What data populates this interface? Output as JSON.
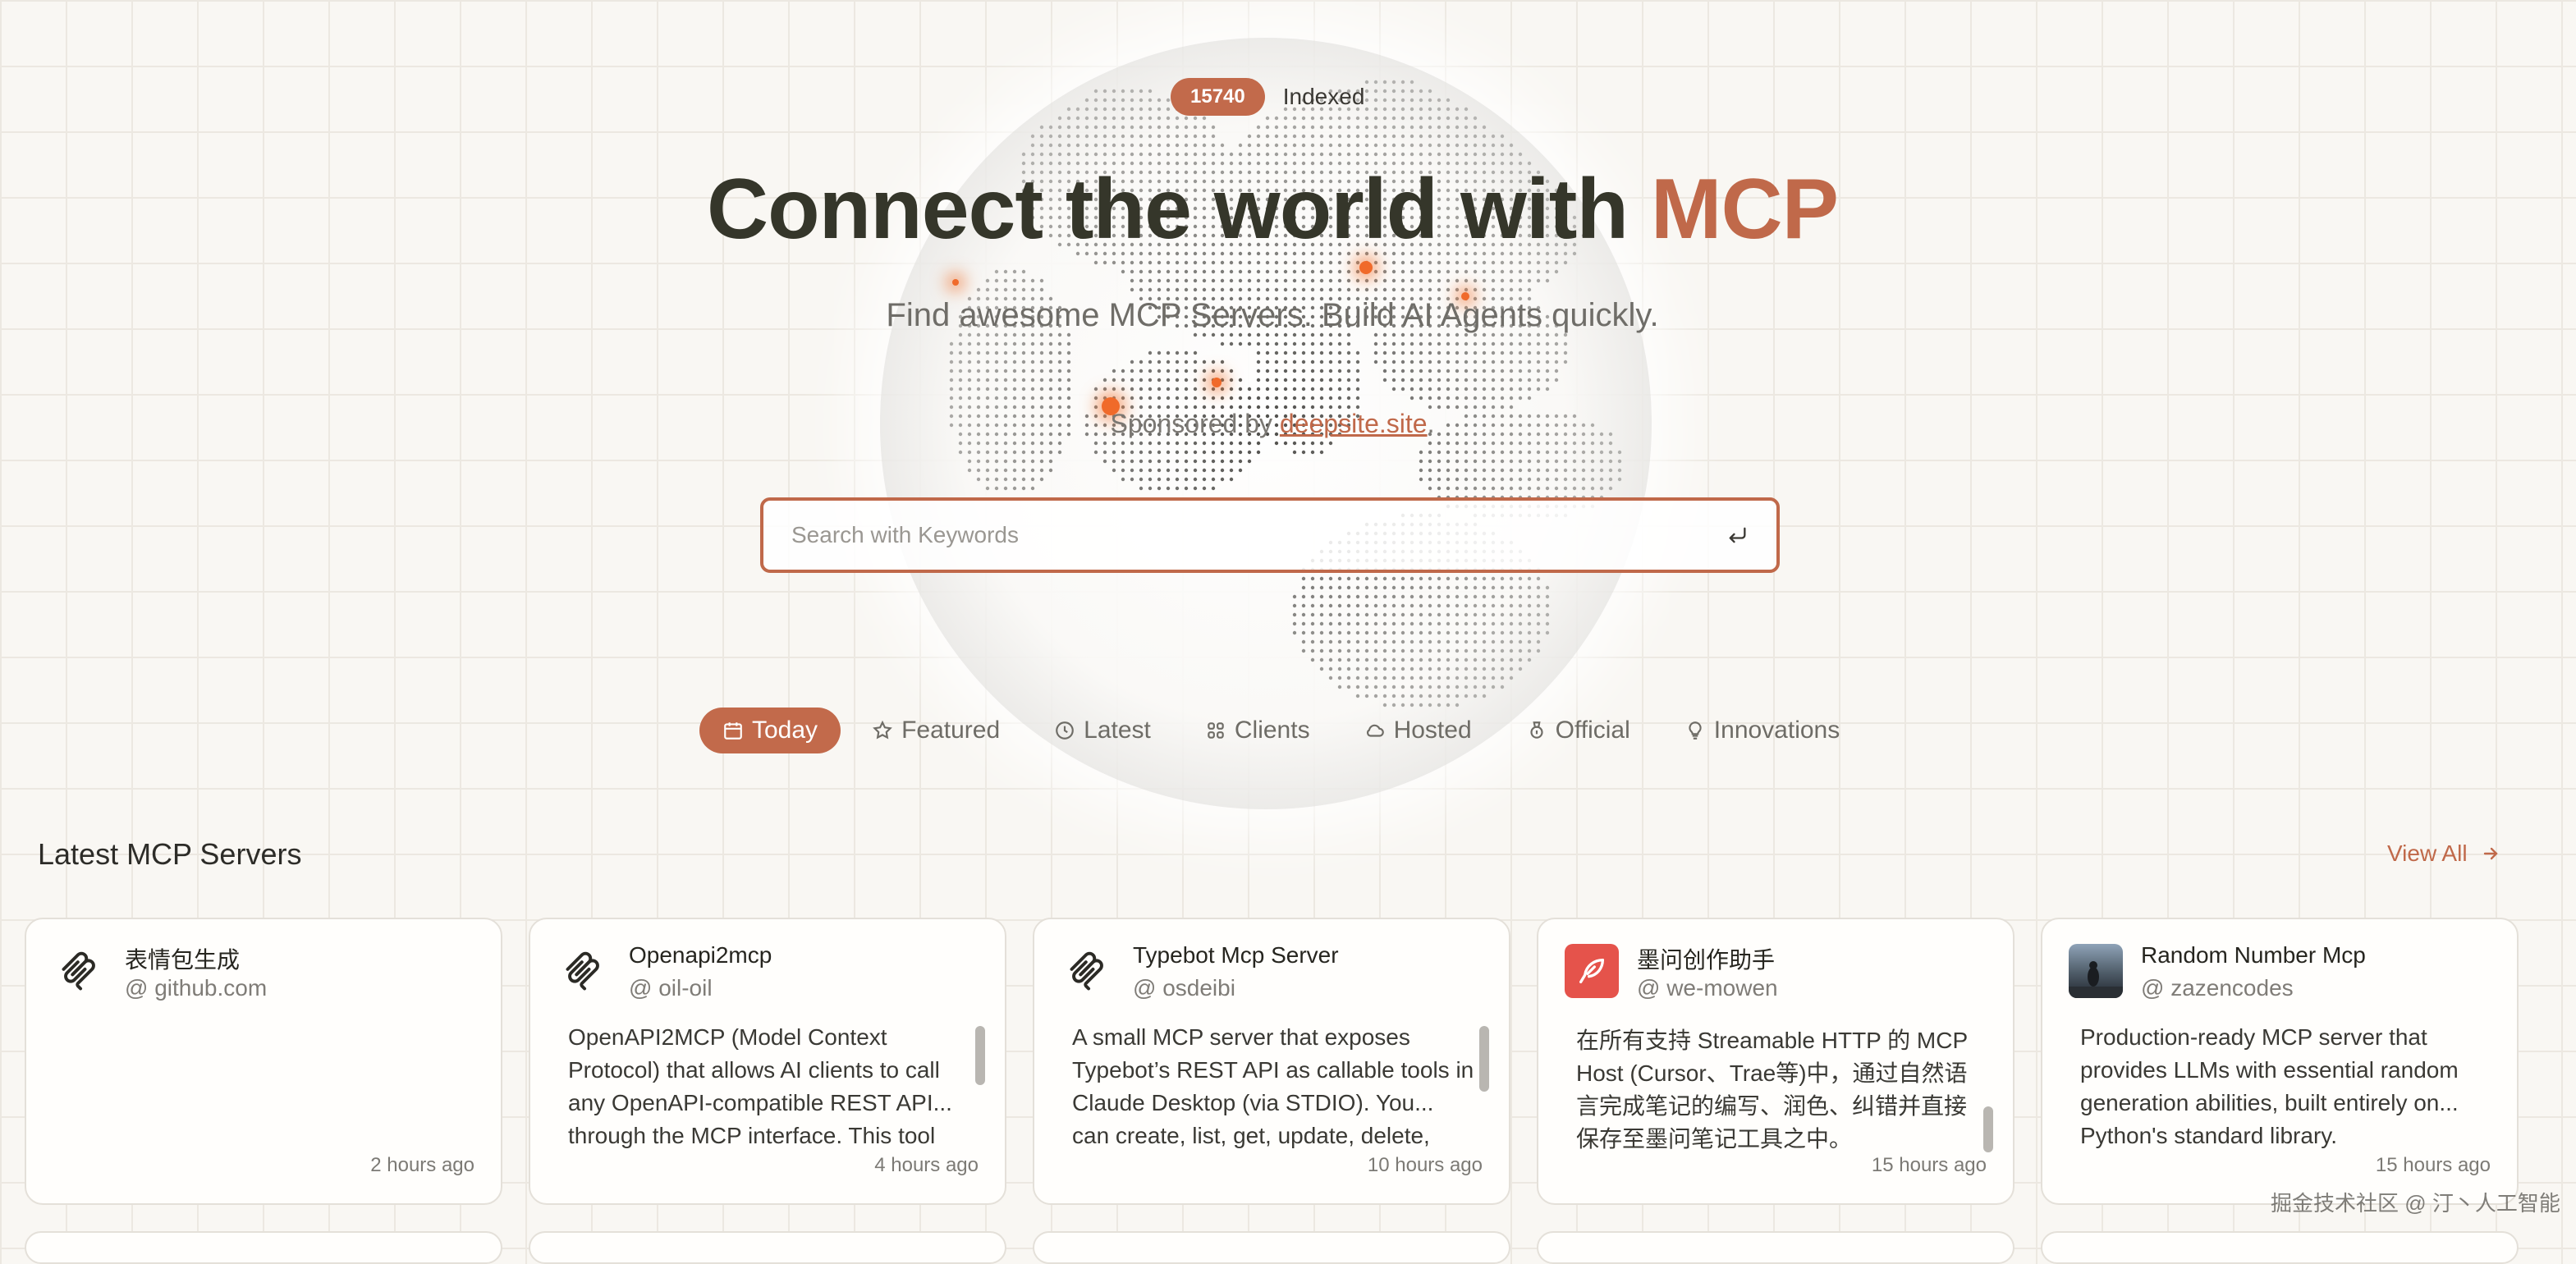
{
  "hero": {
    "indexed_count": "15740",
    "indexed_label": "Indexed",
    "title_main": "Connect the world with ",
    "title_accent": "MCP",
    "subtitle": "Find awesome MCP Servers. Build AI Agents quickly.",
    "sponsor_prefix": "Sponsored by ",
    "sponsor_link": "deepsite.site",
    "sponsor_suffix": "."
  },
  "search": {
    "placeholder": "Search with Keywords"
  },
  "tabs": [
    {
      "label": "Today",
      "icon": "calendar-icon",
      "active": true
    },
    {
      "label": "Featured",
      "icon": "star-icon",
      "active": false
    },
    {
      "label": "Latest",
      "icon": "clock-icon",
      "active": false
    },
    {
      "label": "Clients",
      "icon": "grid-icon",
      "active": false
    },
    {
      "label": "Hosted",
      "icon": "cloud-icon",
      "active": false
    },
    {
      "label": "Official",
      "icon": "badge-icon",
      "active": false
    },
    {
      "label": "Innovations",
      "icon": "lightbulb-icon",
      "active": false
    }
  ],
  "section": {
    "title": "Latest MCP Servers",
    "view_all": "View All"
  },
  "cards": [
    {
      "name": "表情包生成",
      "host": "@ github.com",
      "desc": "",
      "time": "2 hours ago",
      "logo": "mcp-logo-icon"
    },
    {
      "name": "Openapi2mcp",
      "host": "@ oil-oil",
      "desc": "OpenAPI2MCP (Model Context Protocol) that allows AI clients to call any OpenAPI-compatible REST API... through the MCP interface. This tool",
      "time": "4 hours ago",
      "logo": "mcp-logo-icon"
    },
    {
      "name": "Typebot Mcp Server",
      "host": "@ osdeibi",
      "desc": "A small MCP server that exposes Typebot’s REST API as callable tools in Claude Desktop (via STDIO). You... can create, list, get, update, delete,",
      "time": "10 hours ago",
      "logo": "mcp-logo-icon"
    },
    {
      "name": "墨问创作助手",
      "host": "@ we-mowen",
      "desc": "在所有支持 Streamable HTTP 的 MCP Host (Cursor、Trae等)中，通过自然语言完成笔记的编写、润色、纠错并直接保存至墨问笔记工具之中。",
      "time": "15 hours ago",
      "logo": "feather-icon"
    },
    {
      "name": "Random Number Mcp",
      "host": "@ zazencodes",
      "desc": "Production-ready MCP server that provides LLMs with essential random generation abilities, built entirely on... Python's standard library.",
      "time": "15 hours ago",
      "logo": "avatar-photo"
    }
  ],
  "watermark": "掘金技术社区 @ 汀丶人工智能",
  "colors": {
    "accent": "#c0694a",
    "background": "#f9f7f3",
    "title": "#35362a"
  }
}
